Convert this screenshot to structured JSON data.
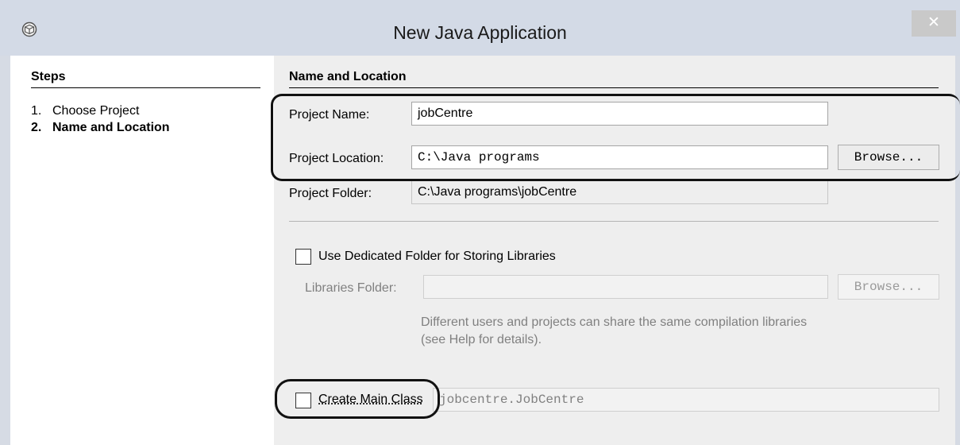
{
  "window": {
    "title": "New Java Application",
    "close_label": "✕"
  },
  "steps": {
    "title": "Steps",
    "items": [
      {
        "num": "1.",
        "label": "Choose Project"
      },
      {
        "num": "2.",
        "label": "Name and Location"
      }
    ]
  },
  "main": {
    "section_title": "Name and Location",
    "project_name": {
      "label": "Project Name:",
      "value": "jobCentre"
    },
    "project_location": {
      "label": "Project Location:",
      "value": "C:\\Java programs",
      "browse_label": "Browse..."
    },
    "project_folder": {
      "label": "Project Folder:",
      "value": "C:\\Java programs\\jobCentre"
    },
    "dedicated_folder": {
      "label": "Use Dedicated Folder for Storing Libraries",
      "checked": false
    },
    "libraries_folder": {
      "label": "Libraries Folder:",
      "value": "",
      "browse_label": "Browse..."
    },
    "help_text": "Different users and projects can share the same compilation libraries (see Help for details).",
    "create_main_class": {
      "label": "Create Main Class",
      "checked": false,
      "value": "jobcentre.JobCentre"
    }
  },
  "colors": {
    "titlebar": "#d3dae6",
    "pane_bg": "#eeeeee",
    "disabled_text": "#808080"
  }
}
